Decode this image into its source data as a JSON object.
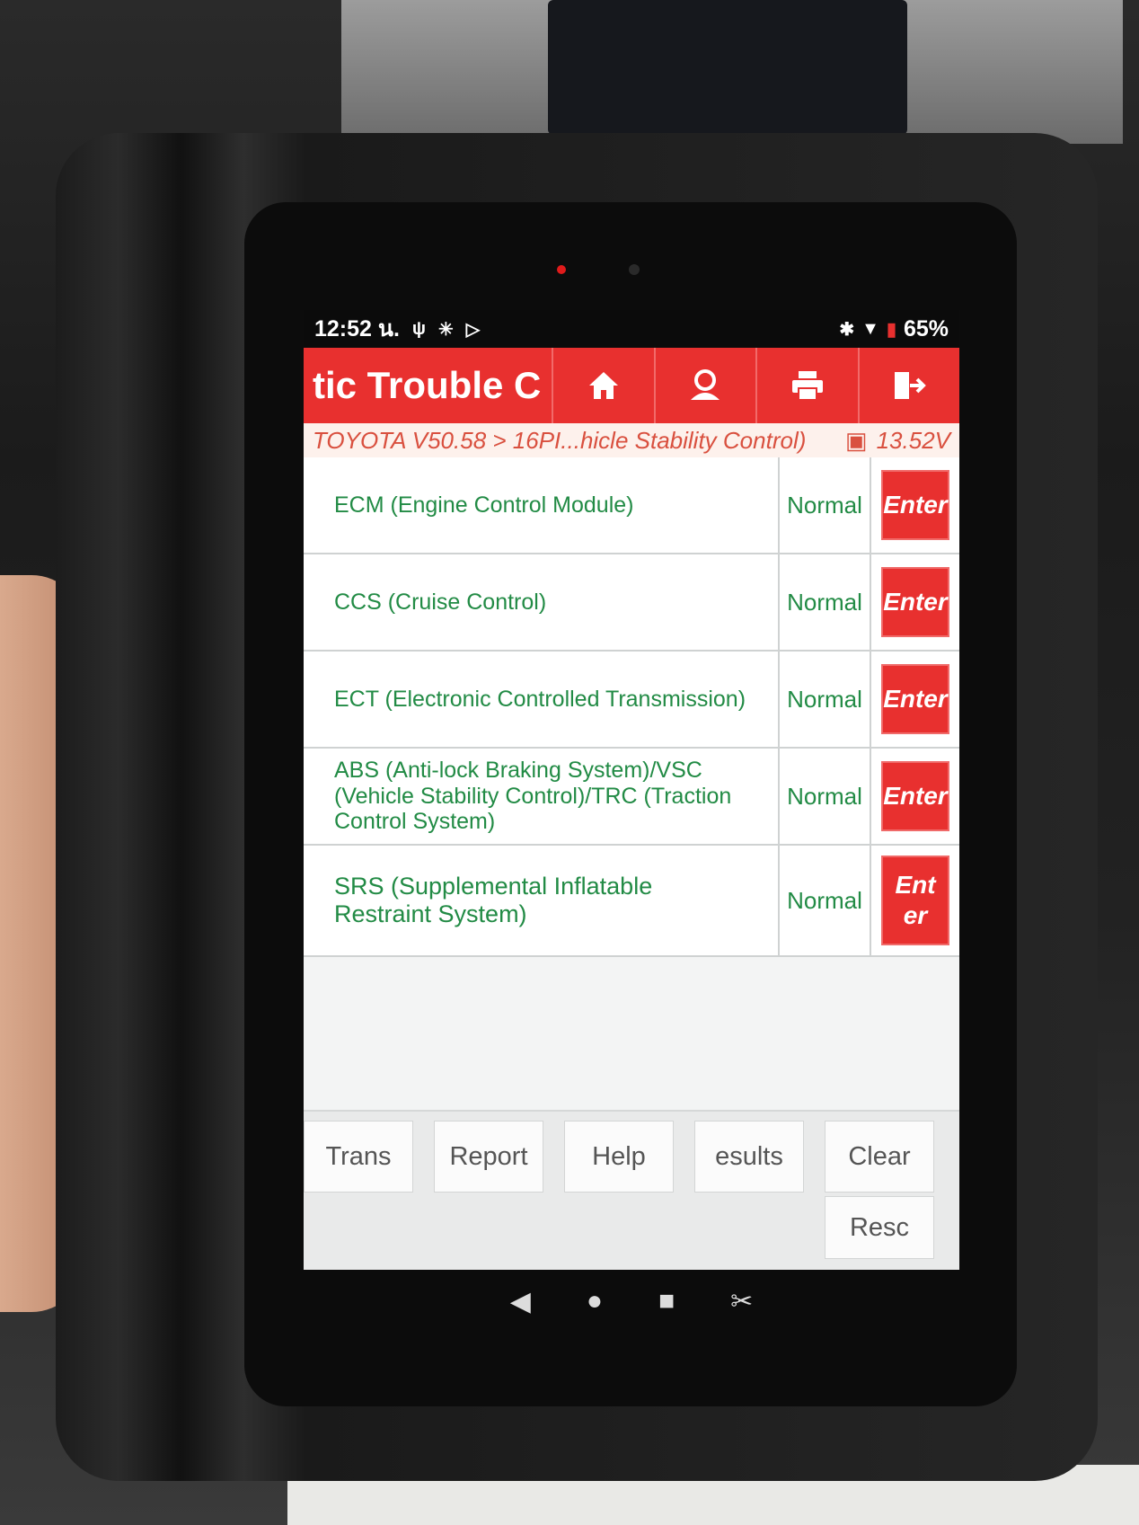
{
  "status_bar": {
    "time": "12:52 น.",
    "battery": "65%"
  },
  "header": {
    "title": "tic Trouble C",
    "buttons": [
      {
        "icon": "home-icon"
      },
      {
        "icon": "support-icon"
      },
      {
        "icon": "print-icon"
      },
      {
        "icon": "exit-icon"
      }
    ]
  },
  "breadcrumb": {
    "path": "TOYOTA V50.58 > 16PI...hicle Stability Control)",
    "voltage": "13.52V"
  },
  "systems": [
    {
      "name": "ECM (Engine Control Module)",
      "status": "Normal",
      "action": "Enter"
    },
    {
      "name": "CCS (Cruise Control)",
      "status": "Normal",
      "action": "Enter"
    },
    {
      "name": "ECT (Electronic Controlled Transmission)",
      "status": "Normal",
      "action": "Enter"
    },
    {
      "name": "ABS (Anti-lock Braking System)/VSC (Vehicle Stability Control)/TRC (Traction Control System)",
      "status": "Normal",
      "action": "Enter"
    },
    {
      "name": "SRS (Supplemental Inflatable Restraint System)",
      "status": "Normal",
      "action": "Ent er"
    }
  ],
  "bottom_buttons": {
    "trans": "Trans",
    "report": "Report",
    "help": "Help",
    "results": "esults",
    "clear": "Clear",
    "rescan": "Resc"
  },
  "colors": {
    "accent": "#e8302f",
    "status_text": "#228b45"
  }
}
